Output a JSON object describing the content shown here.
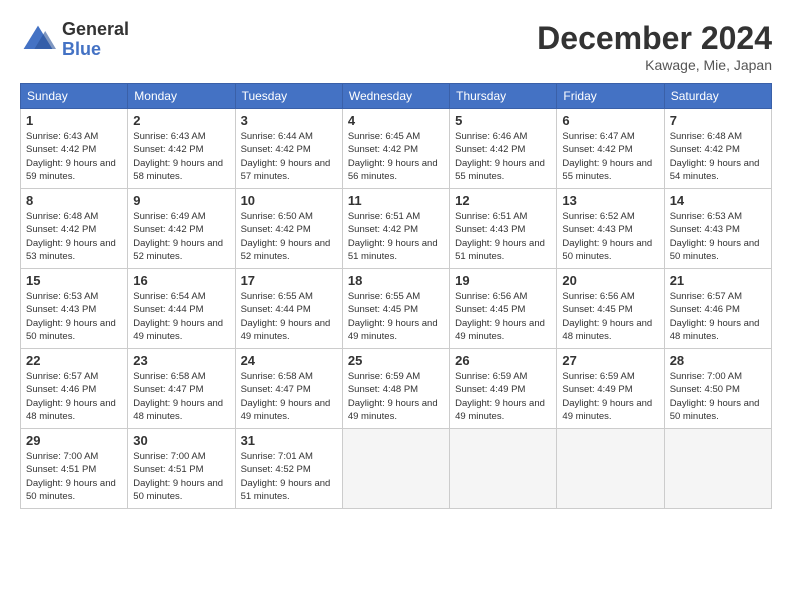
{
  "header": {
    "logo_line1": "General",
    "logo_line2": "Blue",
    "month": "December 2024",
    "location": "Kawage, Mie, Japan"
  },
  "weekdays": [
    "Sunday",
    "Monday",
    "Tuesday",
    "Wednesday",
    "Thursday",
    "Friday",
    "Saturday"
  ],
  "weeks": [
    [
      {
        "day": 1,
        "sunrise": "6:43 AM",
        "sunset": "4:42 PM",
        "daylight": "9 hours and 59 minutes."
      },
      {
        "day": 2,
        "sunrise": "6:43 AM",
        "sunset": "4:42 PM",
        "daylight": "9 hours and 58 minutes."
      },
      {
        "day": 3,
        "sunrise": "6:44 AM",
        "sunset": "4:42 PM",
        "daylight": "9 hours and 57 minutes."
      },
      {
        "day": 4,
        "sunrise": "6:45 AM",
        "sunset": "4:42 PM",
        "daylight": "9 hours and 56 minutes."
      },
      {
        "day": 5,
        "sunrise": "6:46 AM",
        "sunset": "4:42 PM",
        "daylight": "9 hours and 55 minutes."
      },
      {
        "day": 6,
        "sunrise": "6:47 AM",
        "sunset": "4:42 PM",
        "daylight": "9 hours and 55 minutes."
      },
      {
        "day": 7,
        "sunrise": "6:48 AM",
        "sunset": "4:42 PM",
        "daylight": "9 hours and 54 minutes."
      }
    ],
    [
      {
        "day": 8,
        "sunrise": "6:48 AM",
        "sunset": "4:42 PM",
        "daylight": "9 hours and 53 minutes."
      },
      {
        "day": 9,
        "sunrise": "6:49 AM",
        "sunset": "4:42 PM",
        "daylight": "9 hours and 52 minutes."
      },
      {
        "day": 10,
        "sunrise": "6:50 AM",
        "sunset": "4:42 PM",
        "daylight": "9 hours and 52 minutes."
      },
      {
        "day": 11,
        "sunrise": "6:51 AM",
        "sunset": "4:42 PM",
        "daylight": "9 hours and 51 minutes."
      },
      {
        "day": 12,
        "sunrise": "6:51 AM",
        "sunset": "4:43 PM",
        "daylight": "9 hours and 51 minutes."
      },
      {
        "day": 13,
        "sunrise": "6:52 AM",
        "sunset": "4:43 PM",
        "daylight": "9 hours and 50 minutes."
      },
      {
        "day": 14,
        "sunrise": "6:53 AM",
        "sunset": "4:43 PM",
        "daylight": "9 hours and 50 minutes."
      }
    ],
    [
      {
        "day": 15,
        "sunrise": "6:53 AM",
        "sunset": "4:43 PM",
        "daylight": "9 hours and 50 minutes."
      },
      {
        "day": 16,
        "sunrise": "6:54 AM",
        "sunset": "4:44 PM",
        "daylight": "9 hours and 49 minutes."
      },
      {
        "day": 17,
        "sunrise": "6:55 AM",
        "sunset": "4:44 PM",
        "daylight": "9 hours and 49 minutes."
      },
      {
        "day": 18,
        "sunrise": "6:55 AM",
        "sunset": "4:45 PM",
        "daylight": "9 hours and 49 minutes."
      },
      {
        "day": 19,
        "sunrise": "6:56 AM",
        "sunset": "4:45 PM",
        "daylight": "9 hours and 49 minutes."
      },
      {
        "day": 20,
        "sunrise": "6:56 AM",
        "sunset": "4:45 PM",
        "daylight": "9 hours and 48 minutes."
      },
      {
        "day": 21,
        "sunrise": "6:57 AM",
        "sunset": "4:46 PM",
        "daylight": "9 hours and 48 minutes."
      }
    ],
    [
      {
        "day": 22,
        "sunrise": "6:57 AM",
        "sunset": "4:46 PM",
        "daylight": "9 hours and 48 minutes."
      },
      {
        "day": 23,
        "sunrise": "6:58 AM",
        "sunset": "4:47 PM",
        "daylight": "9 hours and 48 minutes."
      },
      {
        "day": 24,
        "sunrise": "6:58 AM",
        "sunset": "4:47 PM",
        "daylight": "9 hours and 49 minutes."
      },
      {
        "day": 25,
        "sunrise": "6:59 AM",
        "sunset": "4:48 PM",
        "daylight": "9 hours and 49 minutes."
      },
      {
        "day": 26,
        "sunrise": "6:59 AM",
        "sunset": "4:49 PM",
        "daylight": "9 hours and 49 minutes."
      },
      {
        "day": 27,
        "sunrise": "6:59 AM",
        "sunset": "4:49 PM",
        "daylight": "9 hours and 49 minutes."
      },
      {
        "day": 28,
        "sunrise": "7:00 AM",
        "sunset": "4:50 PM",
        "daylight": "9 hours and 50 minutes."
      }
    ],
    [
      {
        "day": 29,
        "sunrise": "7:00 AM",
        "sunset": "4:51 PM",
        "daylight": "9 hours and 50 minutes."
      },
      {
        "day": 30,
        "sunrise": "7:00 AM",
        "sunset": "4:51 PM",
        "daylight": "9 hours and 50 minutes."
      },
      {
        "day": 31,
        "sunrise": "7:01 AM",
        "sunset": "4:52 PM",
        "daylight": "9 hours and 51 minutes."
      },
      null,
      null,
      null,
      null
    ]
  ]
}
